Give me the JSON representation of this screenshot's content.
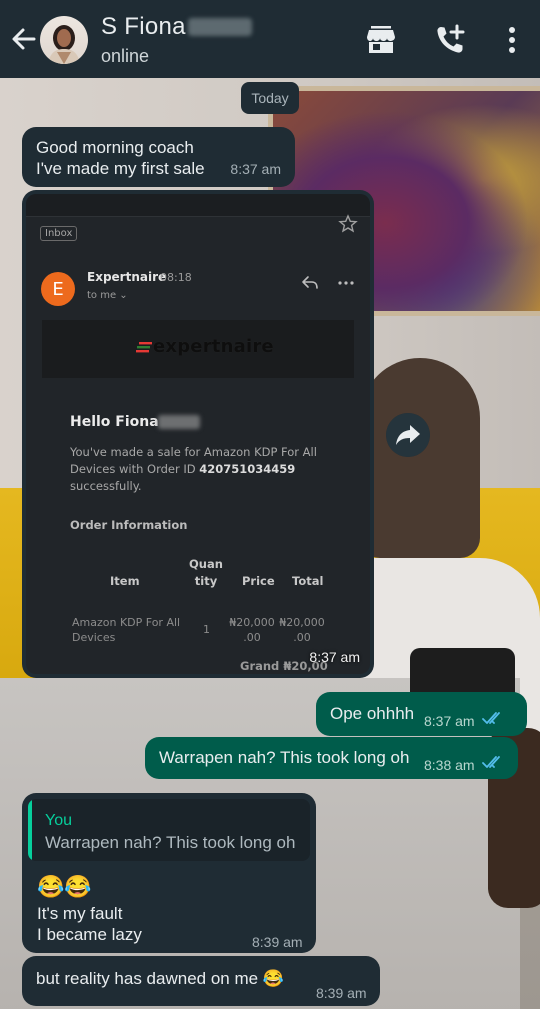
{
  "header": {
    "contact_name": "S Fiona",
    "status": "online",
    "icons": [
      "back-arrow-icon",
      "shop-icon",
      "add-call-icon",
      "more-vert-icon"
    ]
  },
  "chat": {
    "date_chip": "Today",
    "messages": [
      {
        "dir": "in",
        "text_line1": "Good morning coach",
        "text_line2": "I've made my first sale",
        "time": "8:37 am"
      },
      {
        "dir": "in",
        "type": "image",
        "time": "8:37 am"
      },
      {
        "dir": "out",
        "text": "Ope ohhhh",
        "time": "8:37 am",
        "status": "read"
      },
      {
        "dir": "out",
        "text": "Warrapen nah? This took long oh",
        "time": "8:38 am",
        "status": "read"
      },
      {
        "dir": "in",
        "quote_author": "You",
        "quote_text": "Warrapen nah? This took long oh",
        "emoji": "😂😂",
        "line1": "It's my fault",
        "line2": "I became lazy",
        "time": "8:39 am"
      },
      {
        "dir": "in",
        "text": "but reality has dawned on me 😂",
        "time": "8:39 am"
      }
    ]
  },
  "email_screenshot": {
    "inbox_label": "Inbox",
    "sender_initial": "E",
    "sender_name": "Expertnaire",
    "sender_time": "08:18",
    "to_line": "to me ⌄",
    "logo_text": "expertnaire",
    "greeting": "Hello Fiona",
    "sale_text_1": "You've made a sale for Amazon KDP For All Devices with Order ID ",
    "order_id": "420751034459",
    "sale_text_2": " successfully.",
    "order_info_title": "Order Information",
    "table": {
      "headers": [
        "Item",
        "Quan tity",
        "Price",
        "Total"
      ],
      "row": {
        "item": "Amazon KDP For All Devices",
        "qty": "1",
        "price": "₦20,000 .00",
        "total": "₦20,000 .00"
      }
    },
    "grand_label": "Grand",
    "grand_value": "₦20,00",
    "colors": {
      "avatar": "#ED6A1D",
      "logo_mark_red": "#E53935",
      "logo_mark_green": "#2E7D32"
    }
  },
  "colors": {
    "header_bg": "#1F2C34",
    "incoming_bubble": "#1F2C34",
    "outgoing_bubble": "#005C4B",
    "read_tick": "#53BDEB",
    "quote_accent": "#06CF9C"
  }
}
